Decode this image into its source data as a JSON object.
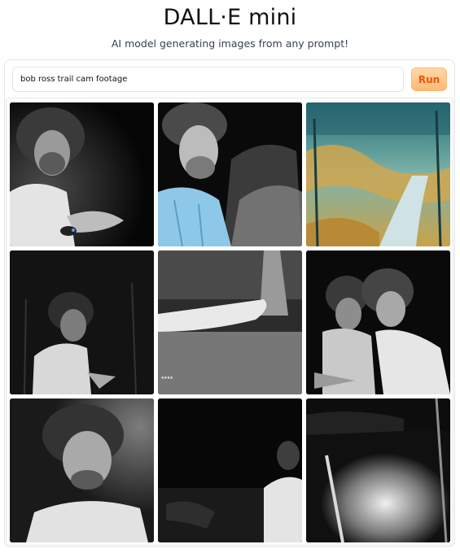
{
  "header": {
    "title": "DALL·E mini",
    "subtitle": "AI model generating images from any prompt!"
  },
  "prompt": {
    "value": "bob ross trail cam footage"
  },
  "run_button": {
    "label": "Run",
    "color": "#ea580c"
  },
  "gallery": {
    "count": 9,
    "images": [
      "man-with-afro-holding-object-night",
      "man-with-afro-blue-shirt-by-tree",
      "painted-forest-path-teal",
      "man-in-white-shirt-dark-forest",
      "fallen-log-forest-floor-night",
      "two-men-with-afros-night",
      "close-up-man-smiling-afro",
      "dark-woods-man-partial",
      "flash-lit-forest-ground"
    ]
  }
}
